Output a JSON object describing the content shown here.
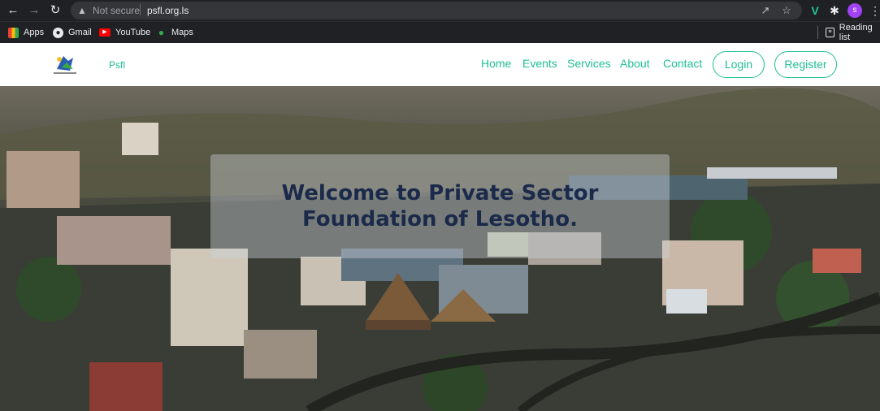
{
  "browser": {
    "not_secure_label": "Not secure",
    "url": "psfl.org.ls",
    "profile_initial": "s"
  },
  "bookmarks": {
    "items": [
      {
        "label": "Apps"
      },
      {
        "label": "Gmail"
      },
      {
        "label": "YouTube"
      },
      {
        "label": "Maps"
      }
    ],
    "reading_list_label": "Reading list"
  },
  "site": {
    "brand": "Psfl",
    "nav": [
      "Home",
      "Events",
      "Services",
      "About",
      "Contact"
    ],
    "login_label": "Login",
    "register_label": "Register",
    "accent_color": "#1fbf94"
  },
  "hero": {
    "title_line1": "Welcome to Private Sector",
    "title_line2": "Foundation of Lesotho."
  }
}
